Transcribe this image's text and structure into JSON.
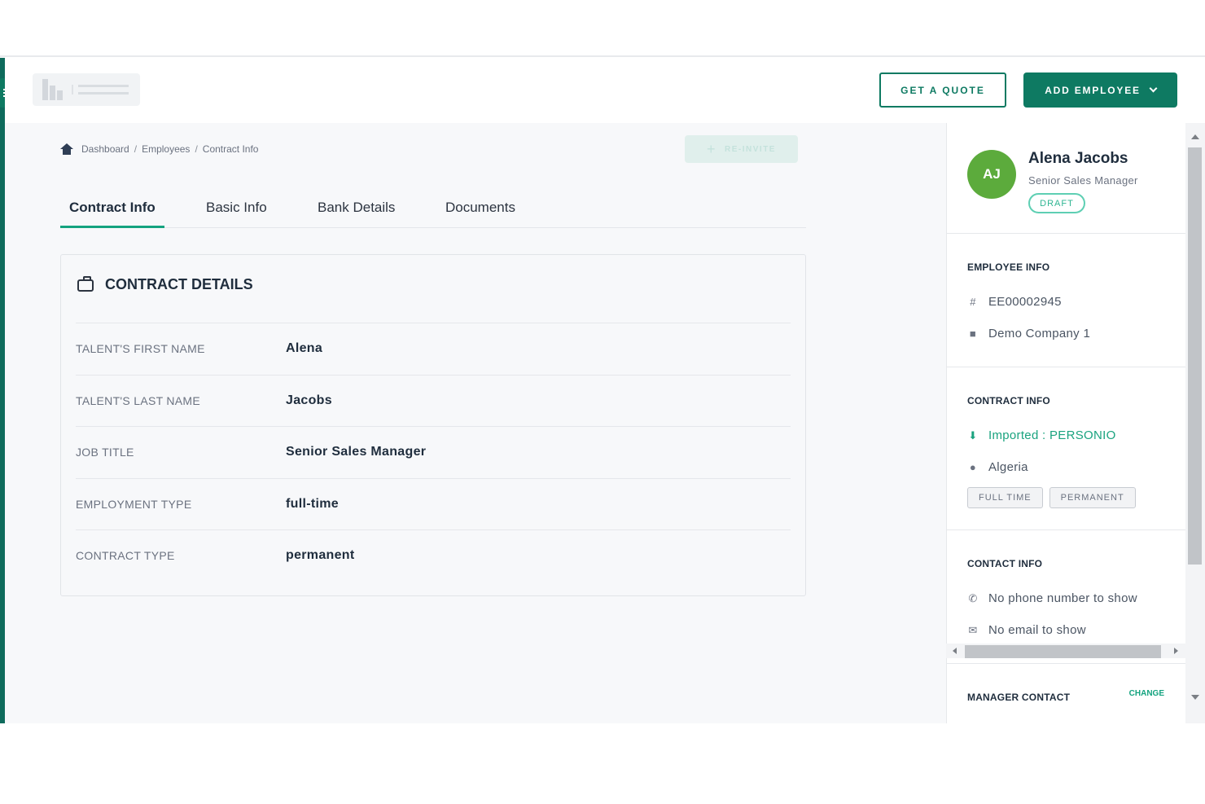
{
  "header": {
    "get_quote_label": "GET A QUOTE",
    "add_employee_label": "ADD EMPLOYEE"
  },
  "breadcrumb": {
    "items": [
      "Dashboard",
      "Employees",
      "Contract Info"
    ],
    "separator": "/"
  },
  "reinvite_label": "RE-INVITE",
  "tabs": [
    {
      "label": "Contract Info",
      "active": true
    },
    {
      "label": "Basic Info",
      "active": false
    },
    {
      "label": "Bank Details",
      "active": false
    },
    {
      "label": "Documents",
      "active": false
    }
  ],
  "contract_details": {
    "title": "CONTRACT DETAILS",
    "rows": [
      {
        "label": "TALENT'S FIRST NAME",
        "value": "Alena"
      },
      {
        "label": "TALENT'S LAST NAME",
        "value": "Jacobs"
      },
      {
        "label": "JOB TITLE",
        "value": "Senior Sales Manager"
      },
      {
        "label": "EMPLOYMENT TYPE",
        "value": "full-time"
      },
      {
        "label": "CONTRACT TYPE",
        "value": "permanent"
      }
    ]
  },
  "profile": {
    "initials": "AJ",
    "name": "Alena Jacobs",
    "role": "Senior Sales Manager",
    "status": "DRAFT",
    "avatar_color": "#5cab3c"
  },
  "employee_info": {
    "title": "EMPLOYEE INFO",
    "id": "EE00002945",
    "company": "Demo Company 1"
  },
  "contract_info": {
    "title": "CONTRACT INFO",
    "imported": "Imported : PERSONIO",
    "country": "Algeria",
    "chips": [
      "FULL TIME",
      "PERMANENT"
    ]
  },
  "contact_info": {
    "title": "CONTACT INFO",
    "phone": "No phone number to show",
    "email": "No email to show"
  },
  "manager_contact": {
    "title": "MANAGER CONTACT",
    "change_label": "CHANGE"
  },
  "colors": {
    "brand": "#0e7a62",
    "accent": "#14a37f",
    "avatar": "#5cab3c"
  }
}
